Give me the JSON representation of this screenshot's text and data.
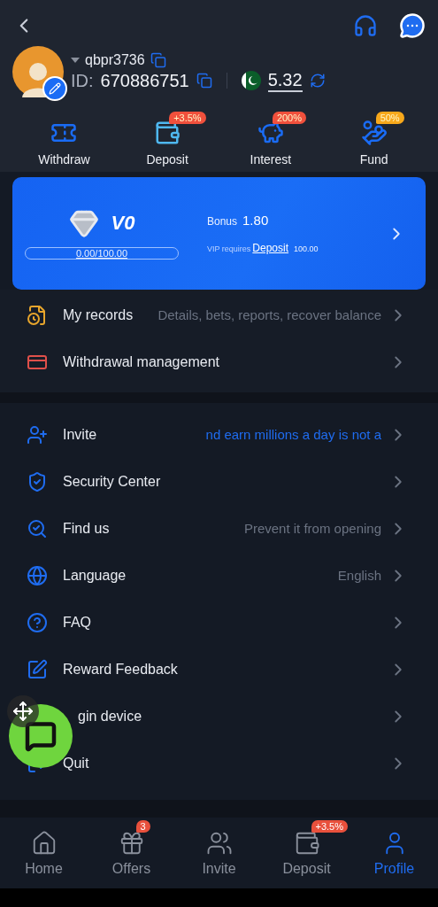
{
  "user": {
    "name": "qbpr3736",
    "id_label": "ID:",
    "id": "670886751",
    "balance": "5.32"
  },
  "quick_actions": [
    {
      "label": "Withdraw",
      "kind": "withdraw"
    },
    {
      "label": "Deposit",
      "kind": "deposit",
      "badge": "+3.5%",
      "color": "#f0503c"
    },
    {
      "label": "Interest",
      "kind": "interest",
      "badge": "200%",
      "color": "#f0503c"
    },
    {
      "label": "Fund",
      "kind": "fund",
      "badge": "50%",
      "color": "#f7a81b"
    }
  ],
  "vip": {
    "level": "V0",
    "progress_text": "0.00/100.00",
    "progress": {
      "level": 0
    },
    "bonus_label": "Bonus",
    "bonus": "1.80",
    "requires_text": "VIP requires",
    "requires_link": "Deposit",
    "requires_amount": "100.00"
  },
  "records": [
    {
      "label": "My records",
      "kind": "records",
      "hint": "Details, bets, reports, recover balance"
    },
    {
      "label": "Withdrawal management",
      "kind": "withdrawal"
    }
  ],
  "menu": [
    {
      "label": "Invite",
      "kind": "invite",
      "hint": "nd earn millions a day is not a",
      "highlighted": true
    },
    {
      "label": "Security Center",
      "kind": "security"
    },
    {
      "label": "Find us",
      "kind": "find",
      "hint": "Prevent it from opening",
      "highlighted": false
    },
    {
      "label": "Language",
      "kind": "language",
      "hint": "English",
      "highlighted": false
    },
    {
      "label": "FAQ",
      "kind": "faq"
    },
    {
      "label": "Reward Feedback",
      "kind": "feedback"
    },
    {
      "label": "gin device"
    },
    {
      "label": "Quit",
      "kind": "quit"
    }
  ],
  "nav": [
    {
      "label": "Home",
      "kind": "home",
      "selected": false
    },
    {
      "label": "Offers",
      "kind": "offers",
      "selected": false,
      "badge": "3"
    },
    {
      "label": "Invite",
      "kind": "invite",
      "selected": false
    },
    {
      "label": "Deposit",
      "kind": "deposit",
      "selected": false,
      "badge": "+3.5%"
    },
    {
      "label": "Profile",
      "kind": "profile",
      "selected": true
    }
  ]
}
